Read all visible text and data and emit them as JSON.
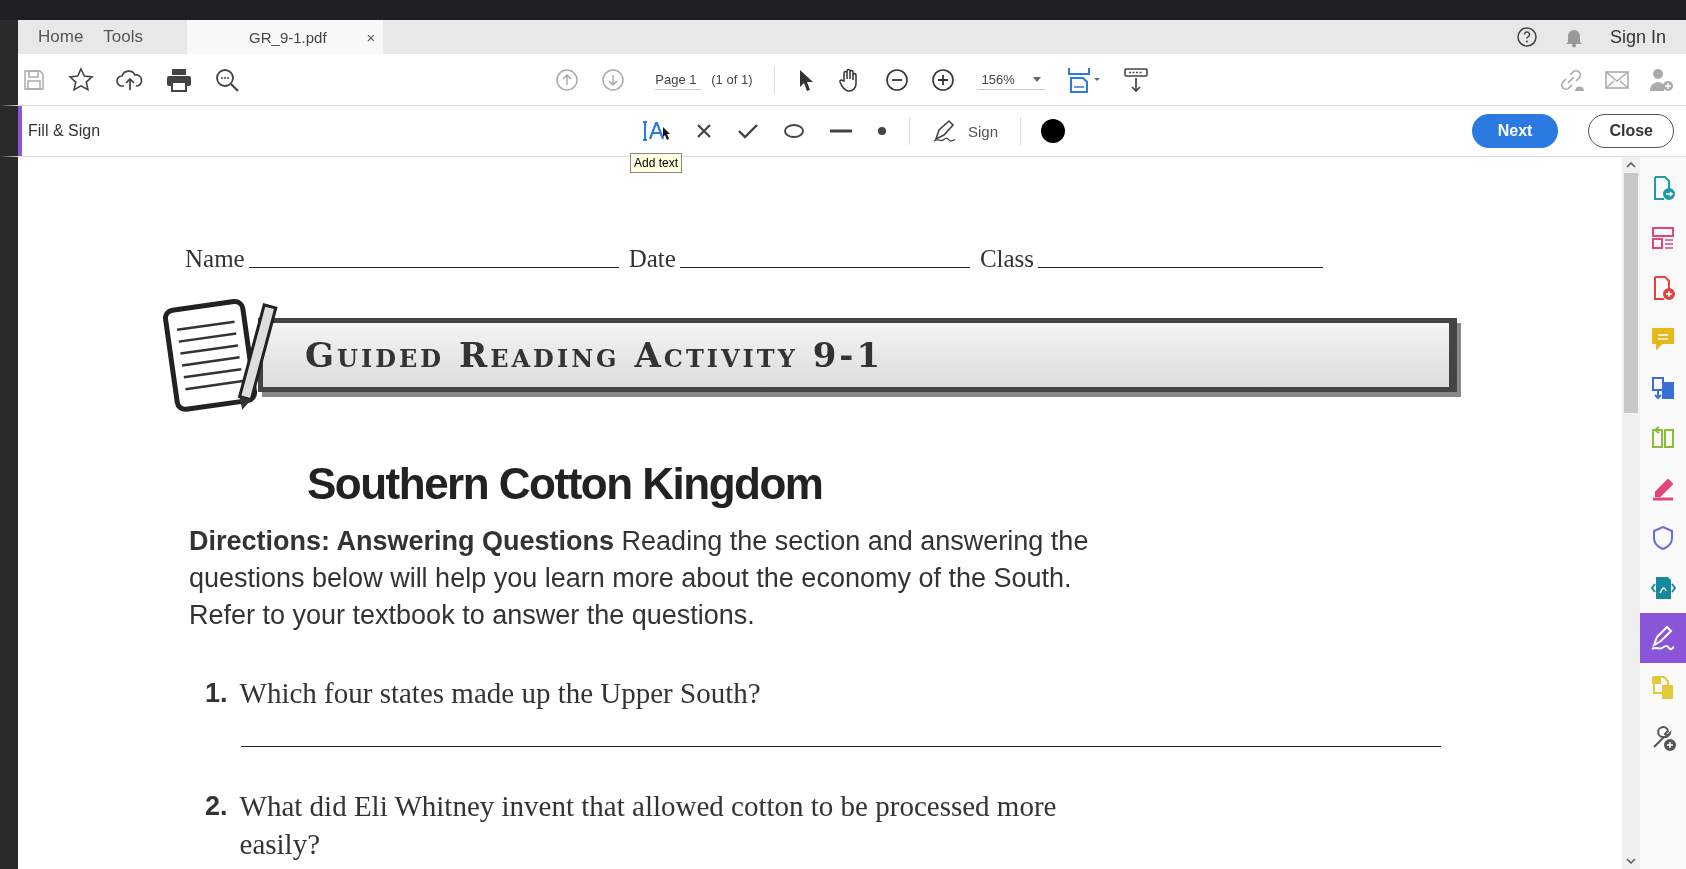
{
  "tabs": [
    {
      "label": "Home",
      "kind": "nav",
      "selected": false
    },
    {
      "label": "Tools",
      "kind": "nav",
      "selected": false
    },
    {
      "label": "GR_9-1.pdf",
      "kind": "document",
      "close": "×",
      "selected": true
    }
  ],
  "account": {
    "sign_in": "Sign In"
  },
  "toolbar": {
    "page_field": "Page 1",
    "page_count": "(1 of 1)",
    "zoom": "156%"
  },
  "fill_sign": {
    "title": "Fill & Sign",
    "tools": [
      {
        "kind": "add-text"
      },
      {
        "kind": "cross"
      },
      {
        "kind": "check"
      },
      {
        "kind": "ellipse"
      },
      {
        "kind": "line"
      },
      {
        "kind": "dot"
      },
      {
        "kind": "sign",
        "label": "Sign"
      }
    ],
    "color": "#000000",
    "tooltip": "Add text",
    "next": "Next",
    "close": "Close"
  },
  "tool_panel": [
    {
      "kind": "doc-arrow",
      "color": "#1f9aa6",
      "selected": false
    },
    {
      "kind": "layout",
      "color": "#e0457b",
      "selected": false
    },
    {
      "kind": "doc-plus",
      "color": "#e0453e",
      "selected": false
    },
    {
      "kind": "comment",
      "color": "#e8b71a",
      "selected": false
    },
    {
      "kind": "doc-pair",
      "color": "#3b6fd8",
      "selected": false
    },
    {
      "kind": "columns",
      "color": "#8dbb3a",
      "selected": false
    },
    {
      "kind": "pen",
      "color": "#e0457b",
      "selected": false
    },
    {
      "kind": "shield",
      "color": "#6b6be0",
      "selected": false
    },
    {
      "kind": "doc-code",
      "color": "#168a9c",
      "selected": false
    },
    {
      "kind": "signature",
      "color": "#8a55d8",
      "selected": true
    },
    {
      "kind": "doc-copy",
      "color": "#e3c83a",
      "selected": false
    },
    {
      "kind": "wrench-plus",
      "color": "#555555",
      "selected": false
    }
  ],
  "document": {
    "fields": [
      {
        "label": "Name"
      },
      {
        "label": "Date"
      },
      {
        "label": "Class"
      }
    ],
    "banner": "Guided Reading Activity 9-1",
    "title": "Southern Cotton Kingdom",
    "directions": "**Directions: Answering Questions**  Reading the section and answering the questions below will help you learn more about the economy of the South. Refer to your textbook to answer the questions.",
    "questions": [
      {
        "number": "1.",
        "text": "Which four states made up the Upper South?",
        "answer_line": true
      },
      {
        "number": "2.",
        "text": "What did Eli Whitney invent that allowed cotton to be processed more easily?",
        "answer_line": false
      }
    ]
  }
}
